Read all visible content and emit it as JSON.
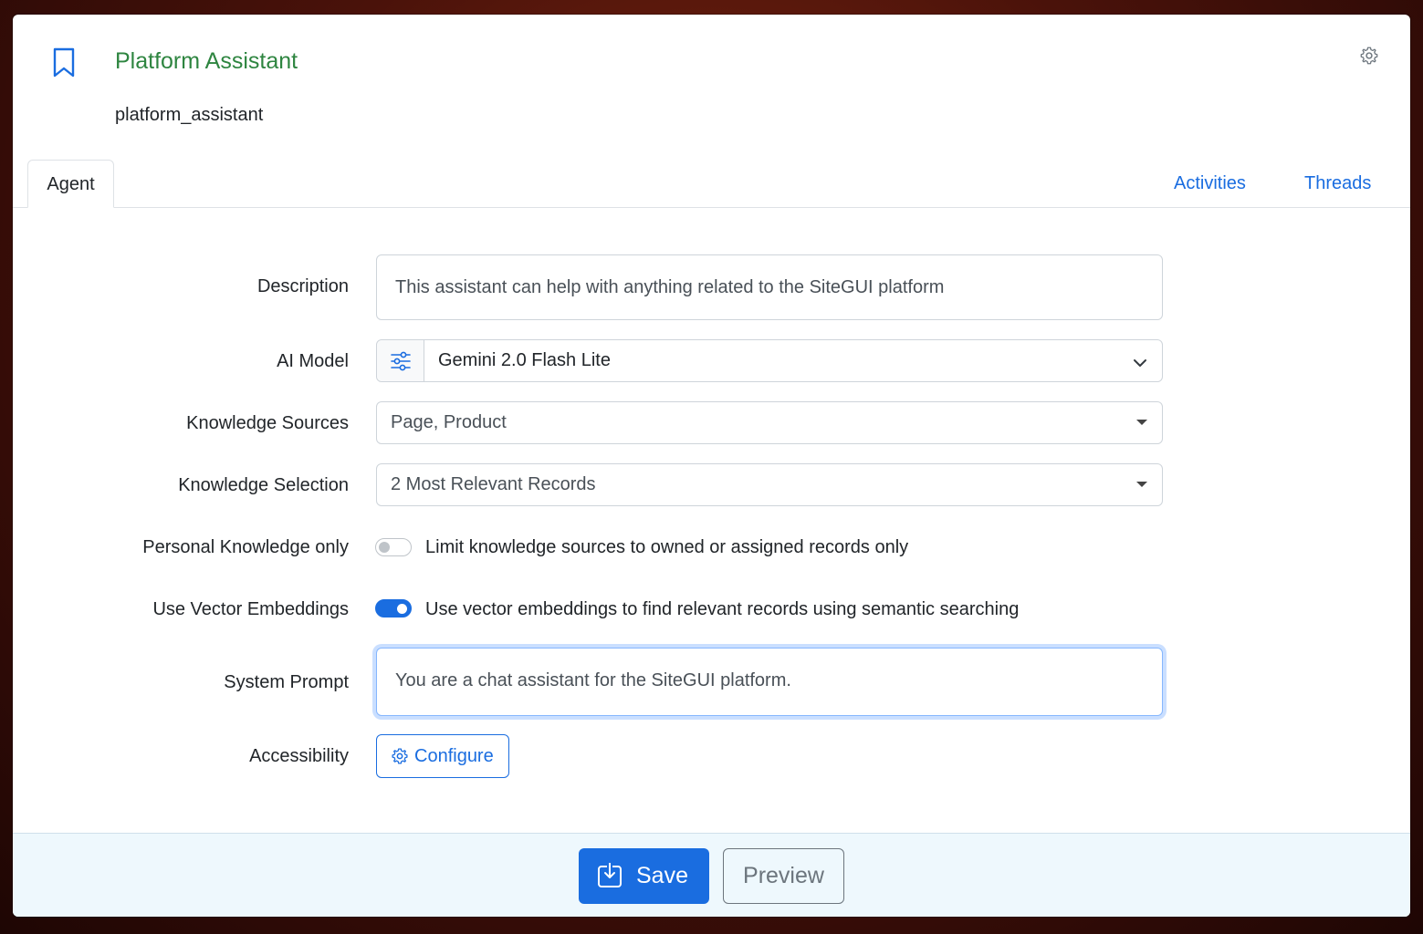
{
  "header": {
    "title": "Platform Assistant",
    "subtitle": "platform_assistant",
    "bookmark_icon": "bookmark-icon",
    "settings_icon": "gear-icon"
  },
  "tabs": [
    {
      "label": "Agent",
      "active": true
    },
    {
      "label": "Activities",
      "active": false
    },
    {
      "label": "Threads",
      "active": false
    }
  ],
  "form": {
    "description": {
      "label": "Description",
      "value": "This assistant can help with anything related to the SiteGUI platform"
    },
    "ai_model": {
      "label": "AI Model",
      "value": "Gemini 2.0 Flash Lite",
      "addon_icon": "sliders-icon"
    },
    "knowledge_sources": {
      "label": "Knowledge Sources",
      "value": "Page, Product"
    },
    "knowledge_selection": {
      "label": "Knowledge Selection",
      "value": "2 Most Relevant Records"
    },
    "personal_knowledge": {
      "label": "Personal Knowledge only",
      "text": "Limit knowledge sources to owned or assigned records only",
      "checked": false
    },
    "vector_embeddings": {
      "label": "Use Vector Embeddings",
      "text": "Use vector embeddings to find relevant records using semantic searching",
      "checked": true
    },
    "system_prompt": {
      "label": "System Prompt",
      "value": "You are a chat assistant for the SiteGUI platform."
    },
    "accessibility": {
      "label": "Accessibility",
      "button_label": "Configure"
    }
  },
  "footer": {
    "save_label": "Save",
    "preview_label": "Preview"
  },
  "colors": {
    "accent": "#1a6de0",
    "title": "#2e8540",
    "footer_bg": "#eef8fd"
  }
}
